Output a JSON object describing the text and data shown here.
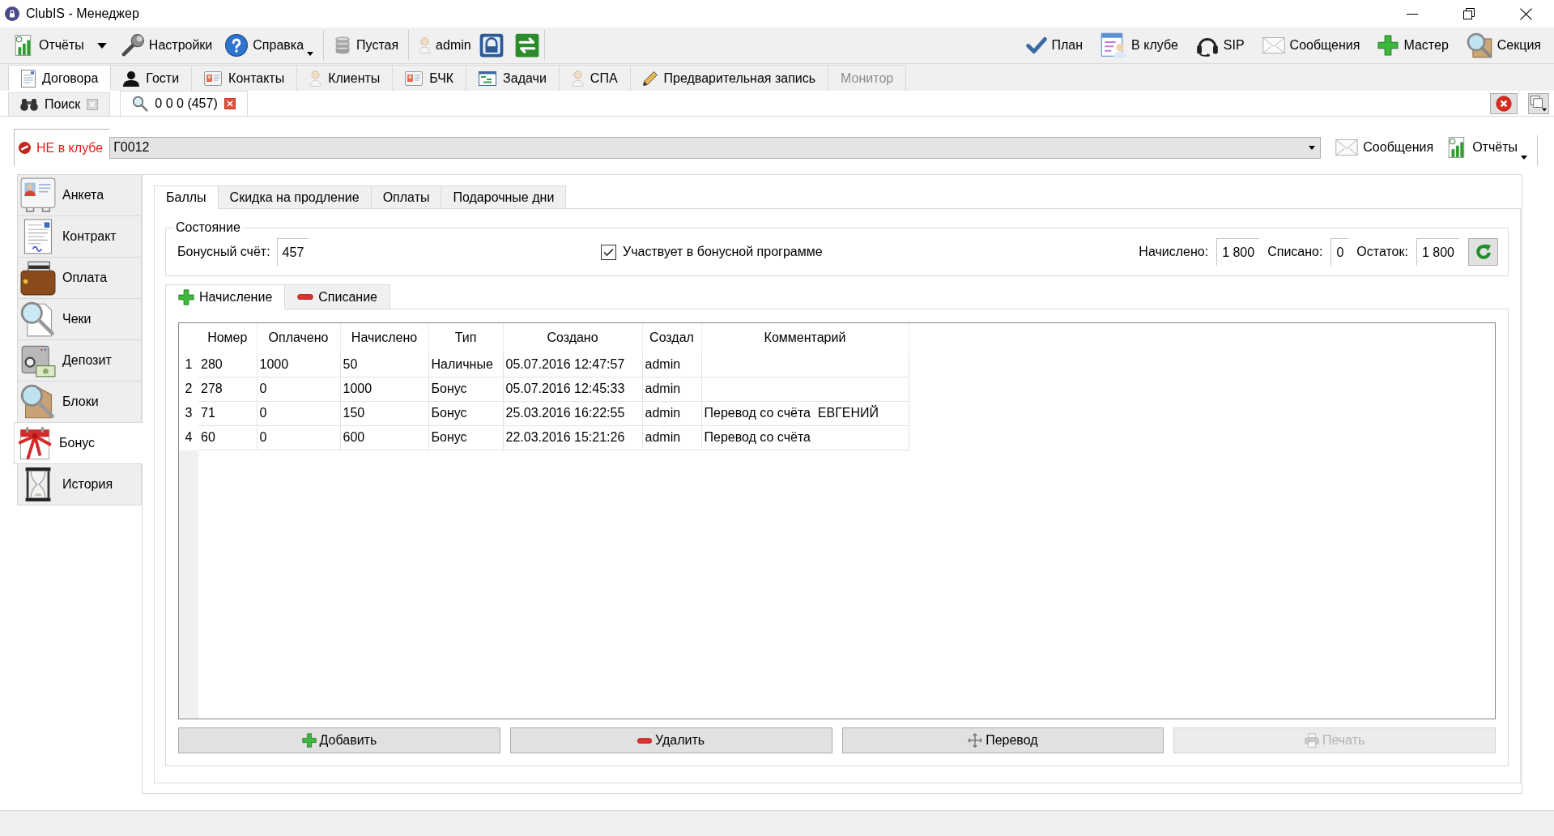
{
  "window": {
    "title": "ClubIS - Менеджер"
  },
  "toolbar": {
    "left_groups": [
      [
        {
          "label": "Отчёты",
          "kind": "split_menu"
        },
        {
          "label": "Настройки",
          "kind": "plain"
        },
        {
          "label": "Справка",
          "kind": "menu"
        }
      ],
      [
        {
          "label": "Пустая",
          "kind": "plain"
        }
      ],
      [
        {
          "label": "admin",
          "kind": "plain"
        }
      ]
    ],
    "right": [
      {
        "label": "План"
      },
      {
        "label": "В клубе"
      },
      {
        "label": "SIP"
      },
      {
        "label": "Сообщения"
      },
      {
        "label": "Мастер"
      },
      {
        "label": "Секция"
      }
    ]
  },
  "main_tabs": [
    {
      "label": "Договора",
      "selected": true,
      "disabled": false
    },
    {
      "label": "Гости",
      "selected": false,
      "disabled": false
    },
    {
      "label": "Контакты",
      "selected": false,
      "disabled": false
    },
    {
      "label": "Клиенты",
      "selected": false,
      "disabled": false
    },
    {
      "label": "БЧК",
      "selected": false,
      "disabled": false
    },
    {
      "label": "Задачи",
      "selected": false,
      "disabled": false
    },
    {
      "label": "СПА",
      "selected": false,
      "disabled": false
    },
    {
      "label": "Предварительная запись",
      "selected": false,
      "disabled": false
    },
    {
      "label": "Монитор",
      "selected": false,
      "disabled": true
    }
  ],
  "document_tabs": [
    {
      "label": "Поиск",
      "selected": false
    },
    {
      "label": "0 0 0 (457)",
      "selected": true
    }
  ],
  "client_bar": {
    "status": "НЕ в клубе",
    "card": "Г0012",
    "buttons": [
      {
        "label": "Сообщения",
        "kind": "plain"
      },
      {
        "label": "Отчёты",
        "kind": "menu"
      }
    ]
  },
  "sidebar": {
    "items": [
      {
        "label": "Анкета",
        "selected": false
      },
      {
        "label": "Контракт",
        "selected": false
      },
      {
        "label": "Оплата",
        "selected": false
      },
      {
        "label": "Чеки",
        "selected": false
      },
      {
        "label": "Депозит",
        "selected": false
      },
      {
        "label": "Блоки",
        "selected": false
      },
      {
        "label": "Бонус",
        "selected": true
      },
      {
        "label": "История",
        "selected": false
      }
    ]
  },
  "tabs": [
    {
      "label": "Баллы",
      "selected": true
    },
    {
      "label": "Скидка на продление",
      "selected": false
    },
    {
      "label": "Оплаты",
      "selected": false
    },
    {
      "label": "Подарочные дни",
      "selected": false
    }
  ],
  "state_group": {
    "title": "Состояние",
    "bonus_account": {
      "label": "Бонусный счёт:",
      "value": "457"
    },
    "participation": {
      "label": "Участвует в бонусной программе",
      "checked": true
    },
    "totals": [
      {
        "label": "Начислено:",
        "value": "1 800"
      },
      {
        "label": "Списано:",
        "value": "0"
      },
      {
        "label": "Остаток:",
        "value": "1 800"
      }
    ]
  },
  "operation_tabs": [
    {
      "label": "Начисление",
      "selected": true
    },
    {
      "label": "Списание",
      "selected": false
    }
  ],
  "table": {
    "columns": [
      "Номер",
      "Оплачено",
      "Начислено",
      "Тип",
      "Создано",
      "Создал",
      "Комментарий"
    ],
    "rows": [
      {
        "index": "1",
        "cells": [
          "280",
          "1000",
          "50",
          "Наличные",
          "05.07.2016 12:47:57",
          "admin"
        ]
      },
      {
        "index": "2",
        "cells": [
          "278",
          "0",
          "1000",
          "Бонус",
          "05.07.2016 12:45:33",
          "admin"
        ]
      },
      {
        "index": "3",
        "cells": [
          "71",
          "0",
          "150",
          "Бонус",
          "25.03.2016 16:22:55",
          "admin",
          "Перевод со счёта  ЕВГЕНИЙ"
        ]
      },
      {
        "index": "4",
        "cells": [
          "60",
          "0",
          "600",
          "Бонус",
          "22.03.2016 15:21:26",
          "admin",
          "Перевод со счёта"
        ]
      }
    ]
  },
  "buttons": [
    {
      "label": "Добавить",
      "disabled": false
    },
    {
      "label": "Удалить",
      "disabled": false
    },
    {
      "label": "Перевод",
      "disabled": false
    },
    {
      "label": "Печать",
      "disabled": true
    }
  ]
}
